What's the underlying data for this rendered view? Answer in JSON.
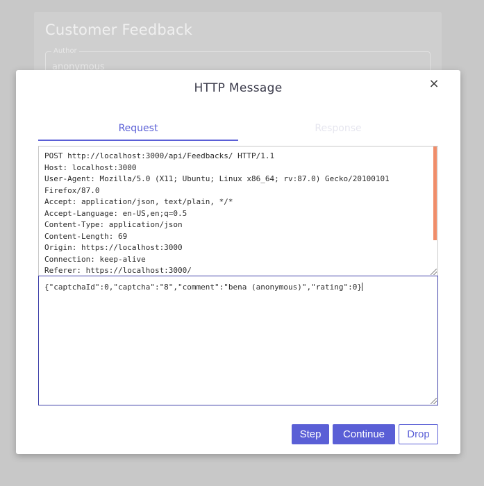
{
  "background_page": {
    "title": "Customer Feedback",
    "author_field": {
      "label": "Author",
      "value": "anonymous"
    }
  },
  "dialog": {
    "title": "HTTP Message",
    "close_label": "×",
    "tabs": [
      {
        "label": "Request",
        "active": true
      },
      {
        "label": "Response",
        "active": false
      }
    ],
    "request_headers": "POST http://localhost:3000/api/Feedbacks/ HTTP/1.1\nHost: localhost:3000\nUser-Agent: Mozilla/5.0 (X11; Ubuntu; Linux x86_64; rv:87.0) Gecko/20100101\nFirefox/87.0\nAccept: application/json, text/plain, */*\nAccept-Language: en-US,en;q=0.5\nContent-Type: application/json\nContent-Length: 69\nOrigin: https://localhost:3000\nConnection: keep-alive\nReferer: https://localhost:3000/",
    "request_body": "{\"captchaId\":0,\"captcha\":\"8\",\"comment\":\"bena (anonymous)\",\"rating\":0}",
    "buttons": {
      "step": "Step",
      "continue": "Continue",
      "drop": "Drop"
    }
  },
  "colors": {
    "accent": "#5a5fd6",
    "scroll_thumb": "#ef8d6a",
    "overlay": "#c8c8c8"
  }
}
